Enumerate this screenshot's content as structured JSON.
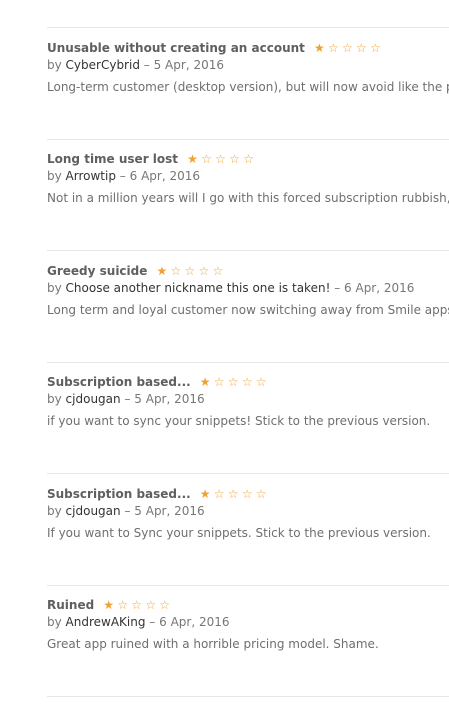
{
  "reviews": [
    {
      "title": "Unusable without creating an account",
      "rating": 1,
      "max_rating": 5,
      "by_prefix": "by",
      "author": "CyberCybrid",
      "date_sep": "–",
      "date": "5 Apr, 2016",
      "body": "Long-term customer (desktop version), but will now avoid like the p"
    },
    {
      "title": "Long time user lost",
      "rating": 1,
      "max_rating": 5,
      "by_prefix": "by",
      "author": "Arrowtip",
      "date_sep": "–",
      "date": "6 Apr, 2016",
      "body": "Not in a million years will I go with this forced subscription rubbish,"
    },
    {
      "title": "Greedy suicide",
      "rating": 1,
      "max_rating": 5,
      "by_prefix": "by",
      "author": "Choose another nickname this one is taken!",
      "date_sep": "–",
      "date": "6 Apr, 2016",
      "body": "Long term and loyal customer now switching away from Smile apps"
    },
    {
      "title": "Subscription based...",
      "rating": 1,
      "max_rating": 5,
      "by_prefix": "by",
      "author": "cjdougan",
      "date_sep": "–",
      "date": "5 Apr, 2016",
      "body": "if you want to sync your snippets! Stick to the previous version."
    },
    {
      "title": "Subscription based...",
      "rating": 1,
      "max_rating": 5,
      "by_prefix": "by",
      "author": "cjdougan",
      "date_sep": "–",
      "date": "5 Apr, 2016",
      "body": "If you want to Sync your snippets. Stick to the previous version."
    },
    {
      "title": "Ruined",
      "rating": 1,
      "max_rating": 5,
      "by_prefix": "by",
      "author": "AndrewAKing",
      "date_sep": "–",
      "date": "6 Apr, 2016",
      "body": "Great app ruined with a horrible pricing model. Shame."
    }
  ],
  "colors": {
    "star": "#f1a12d",
    "divider": "#e6e6e6",
    "text": "#6f6f6f"
  },
  "icons": {
    "filled_star": "filled-star-icon",
    "empty_star": "empty-star-icon"
  }
}
